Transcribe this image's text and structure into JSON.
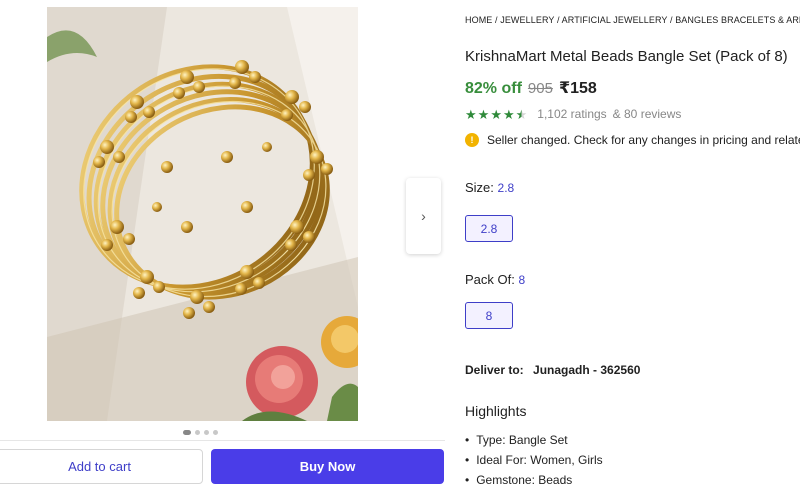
{
  "gallery": {
    "next_icon": "chevron-right-icon",
    "dots_total": 4,
    "dots_active": 1,
    "add_to_cart_label": "Add to cart",
    "buy_now_label": "Buy Now"
  },
  "breadcrumb": [
    "HOME",
    "JEWELLERY",
    "ARTIFICIAL JEWELLERY",
    "BANGLES BRACELETS & ARMLETS"
  ],
  "breadcrumb_sep": "/",
  "product": {
    "title": "KrishnaMart Metal Beads Bangle Set (Pack of 8)",
    "discount": "82% off",
    "mrp": "905",
    "price": "₹158",
    "rating": 4.5,
    "ratings_count": "1,102 ratings",
    "reviews_count": "& 80 reviews"
  },
  "notice": {
    "icon": "info-icon",
    "icon_glyph": "!",
    "text": "Seller changed. Check for any changes in pricing and related"
  },
  "options": {
    "size_label": "Size:",
    "size_selected": "2.8",
    "size_values": [
      "2.8"
    ],
    "pack_label": "Pack Of:",
    "pack_selected": "8",
    "pack_values": [
      "8"
    ]
  },
  "delivery": {
    "label": "Deliver to:",
    "location": "Junagadh - 362560"
  },
  "highlights": {
    "title": "Highlights",
    "items": [
      "Type: Bangle Set",
      "Ideal For: Women, Girls",
      "Gemstone: Beads"
    ]
  },
  "colors": {
    "primary": "#4a3de8",
    "accent_text": "#3e3ec8",
    "discount_green": "#388e3c",
    "star_green": "#2f8a3a",
    "info_yellow": "#f2b300"
  }
}
